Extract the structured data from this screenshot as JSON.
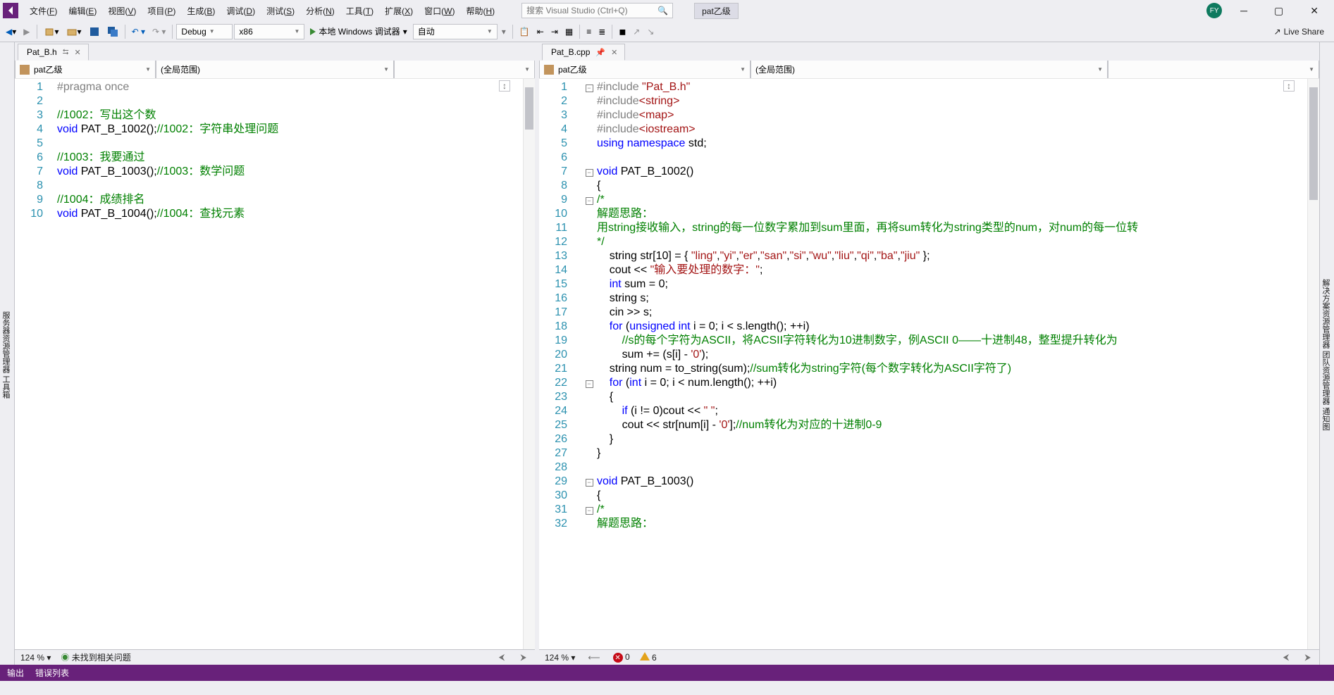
{
  "menubar": {
    "items": [
      "文件(F)",
      "编辑(E)",
      "视图(V)",
      "项目(P)",
      "生成(B)",
      "调试(D)",
      "测试(S)",
      "分析(N)",
      "工具(T)",
      "扩展(X)",
      "窗口(W)",
      "帮助(H)"
    ],
    "search_placeholder": "搜索 Visual Studio (Ctrl+Q)",
    "solution_name": "pat乙级",
    "avatar": "FY"
  },
  "toolbar": {
    "config": "Debug",
    "platform": "x86",
    "debug_label": "本地 Windows 调试器",
    "auto_label": "自动",
    "live_share": "Live Share"
  },
  "left_pane": {
    "tab": "Pat_B.h",
    "project": "pat乙级",
    "scope": "(全局范围)",
    "zoom": "124 %",
    "issues_msg": "未找到相关问题",
    "lines": [
      {
        "n": 1,
        "p": [
          {
            "t": "#pragma",
            "c": "prag"
          },
          {
            "t": " ",
            "c": ""
          },
          {
            "t": "once",
            "c": "prag"
          }
        ]
      },
      {
        "n": 2,
        "p": []
      },
      {
        "n": 3,
        "p": [
          {
            "t": "//1002：写出这个数",
            "c": "cmt"
          }
        ]
      },
      {
        "n": 4,
        "p": [
          {
            "t": "void",
            "c": "kw"
          },
          {
            "t": " PAT_B_1002();",
            "c": ""
          },
          {
            "t": "//1002：字符串处理问题",
            "c": "cmt"
          }
        ]
      },
      {
        "n": 5,
        "p": []
      },
      {
        "n": 6,
        "p": [
          {
            "t": "//1003：我要通过",
            "c": "cmt"
          }
        ]
      },
      {
        "n": 7,
        "p": [
          {
            "t": "void",
            "c": "kw"
          },
          {
            "t": " PAT_B_1003();",
            "c": ""
          },
          {
            "t": "//1003：数学问题",
            "c": "cmt"
          }
        ]
      },
      {
        "n": 8,
        "p": []
      },
      {
        "n": 9,
        "p": [
          {
            "t": "//1004：成绩排名",
            "c": "cmt"
          }
        ]
      },
      {
        "n": 10,
        "p": [
          {
            "t": "void",
            "c": "kw"
          },
          {
            "t": " PAT_B_1004();",
            "c": ""
          },
          {
            "t": "//1004：查找元素",
            "c": "cmt"
          }
        ]
      }
    ]
  },
  "right_pane": {
    "tab": "Pat_B.cpp",
    "project": "pat乙级",
    "scope": "(全局范围)",
    "zoom": "124 %",
    "errors": "0",
    "warnings": "6",
    "lines": [
      {
        "n": 1,
        "f": "-",
        "p": [
          {
            "t": "#include ",
            "c": "prag"
          },
          {
            "t": "\"Pat_B.h\"",
            "c": "inc"
          }
        ]
      },
      {
        "n": 2,
        "f": "",
        "p": [
          {
            "t": "#include",
            "c": "prag"
          },
          {
            "t": "<string>",
            "c": "inc"
          }
        ]
      },
      {
        "n": 3,
        "f": "",
        "p": [
          {
            "t": "#include",
            "c": "prag"
          },
          {
            "t": "<map>",
            "c": "inc"
          }
        ]
      },
      {
        "n": 4,
        "f": "",
        "p": [
          {
            "t": "#include",
            "c": "prag"
          },
          {
            "t": "<iostream>",
            "c": "inc"
          }
        ]
      },
      {
        "n": 5,
        "f": "",
        "p": [
          {
            "t": "using",
            "c": "kw"
          },
          {
            "t": " ",
            "c": ""
          },
          {
            "t": "namespace",
            "c": "kw"
          },
          {
            "t": " std;",
            "c": ""
          }
        ]
      },
      {
        "n": 6,
        "f": "",
        "p": []
      },
      {
        "n": 7,
        "f": "-",
        "p": [
          {
            "t": "void",
            "c": "kw"
          },
          {
            "t": " PAT_B_1002()",
            "c": ""
          }
        ]
      },
      {
        "n": 8,
        "f": "",
        "p": [
          {
            "t": "{",
            "c": ""
          }
        ]
      },
      {
        "n": 9,
        "f": "-",
        "p": [
          {
            "t": "/*",
            "c": "cmt"
          }
        ]
      },
      {
        "n": 10,
        "f": "",
        "p": [
          {
            "t": "解题思路：",
            "c": "cmt"
          }
        ]
      },
      {
        "n": 11,
        "f": "",
        "p": [
          {
            "t": "用string接收输入，string的每一位数字累加到sum里面，再将sum转化为string类型的num，对num的每一位转",
            "c": "cmt"
          }
        ]
      },
      {
        "n": 12,
        "f": "",
        "p": [
          {
            "t": "*/",
            "c": "cmt"
          }
        ]
      },
      {
        "n": 13,
        "f": "",
        "p": [
          {
            "t": "    string str[10] = { ",
            "c": ""
          },
          {
            "t": "\"ling\"",
            "c": "str"
          },
          {
            "t": ",",
            "c": ""
          },
          {
            "t": "\"yi\"",
            "c": "str"
          },
          {
            "t": ",",
            "c": ""
          },
          {
            "t": "\"er\"",
            "c": "str"
          },
          {
            "t": ",",
            "c": ""
          },
          {
            "t": "\"san\"",
            "c": "str"
          },
          {
            "t": ",",
            "c": ""
          },
          {
            "t": "\"si\"",
            "c": "str"
          },
          {
            "t": ",",
            "c": ""
          },
          {
            "t": "\"wu\"",
            "c": "str"
          },
          {
            "t": ",",
            "c": ""
          },
          {
            "t": "\"liu\"",
            "c": "str"
          },
          {
            "t": ",",
            "c": ""
          },
          {
            "t": "\"qi\"",
            "c": "str"
          },
          {
            "t": ",",
            "c": ""
          },
          {
            "t": "\"ba\"",
            "c": "str"
          },
          {
            "t": ",",
            "c": ""
          },
          {
            "t": "\"jiu\"",
            "c": "str"
          },
          {
            "t": " };",
            "c": ""
          }
        ]
      },
      {
        "n": 14,
        "f": "",
        "p": [
          {
            "t": "    cout << ",
            "c": ""
          },
          {
            "t": "\"输入要处理的数字：\"",
            "c": "str"
          },
          {
            "t": ";",
            "c": ""
          }
        ]
      },
      {
        "n": 15,
        "f": "",
        "p": [
          {
            "t": "    ",
            "c": ""
          },
          {
            "t": "int",
            "c": "kw"
          },
          {
            "t": " sum = 0;",
            "c": ""
          }
        ]
      },
      {
        "n": 16,
        "f": "",
        "p": [
          {
            "t": "    string s;",
            "c": ""
          }
        ]
      },
      {
        "n": 17,
        "f": "",
        "p": [
          {
            "t": "    cin >> s;",
            "c": ""
          }
        ]
      },
      {
        "n": 18,
        "f": "",
        "p": [
          {
            "t": "    ",
            "c": ""
          },
          {
            "t": "for",
            "c": "kw"
          },
          {
            "t": " (",
            "c": ""
          },
          {
            "t": "unsigned",
            "c": "kw"
          },
          {
            "t": " ",
            "c": ""
          },
          {
            "t": "int",
            "c": "kw"
          },
          {
            "t": " i = 0; i < s.length(); ++i)",
            "c": ""
          }
        ]
      },
      {
        "n": 19,
        "f": "",
        "p": [
          {
            "t": "        ",
            "c": ""
          },
          {
            "t": "//s的每个字符为ASCII，将ACSII字符转化为10进制数字，例ASCII 0——十进制48，整型提升转化为",
            "c": "cmt"
          }
        ]
      },
      {
        "n": 20,
        "f": "",
        "p": [
          {
            "t": "        sum += (s[i] - ",
            "c": ""
          },
          {
            "t": "'0'",
            "c": "str"
          },
          {
            "t": ");",
            "c": ""
          }
        ]
      },
      {
        "n": 21,
        "f": "",
        "p": [
          {
            "t": "    string num = to_string(sum);",
            "c": ""
          },
          {
            "t": "//sum转化为string字符(每个数字转化为ASCII字符了)",
            "c": "cmt"
          }
        ]
      },
      {
        "n": 22,
        "f": "-",
        "p": [
          {
            "t": "    ",
            "c": ""
          },
          {
            "t": "for",
            "c": "kw"
          },
          {
            "t": " (",
            "c": ""
          },
          {
            "t": "int",
            "c": "kw"
          },
          {
            "t": " i = 0; i < num.length(); ++i)",
            "c": ""
          }
        ]
      },
      {
        "n": 23,
        "f": "",
        "p": [
          {
            "t": "    {",
            "c": ""
          }
        ]
      },
      {
        "n": 24,
        "f": "",
        "p": [
          {
            "t": "        ",
            "c": ""
          },
          {
            "t": "if",
            "c": "kw"
          },
          {
            "t": " (i != 0)cout << ",
            "c": ""
          },
          {
            "t": "\" \"",
            "c": "str"
          },
          {
            "t": ";",
            "c": ""
          }
        ]
      },
      {
        "n": 25,
        "f": "",
        "p": [
          {
            "t": "        cout << str[num[i] - ",
            "c": ""
          },
          {
            "t": "'0'",
            "c": "str"
          },
          {
            "t": "];",
            "c": ""
          },
          {
            "t": "//num转化为对应的十进制0-9",
            "c": "cmt"
          }
        ]
      },
      {
        "n": 26,
        "f": "",
        "p": [
          {
            "t": "    }",
            "c": ""
          }
        ]
      },
      {
        "n": 27,
        "f": "",
        "p": [
          {
            "t": "}",
            "c": ""
          }
        ]
      },
      {
        "n": 28,
        "f": "",
        "p": []
      },
      {
        "n": 29,
        "f": "-",
        "p": [
          {
            "t": "void",
            "c": "kw"
          },
          {
            "t": " PAT_B_1003()",
            "c": ""
          }
        ]
      },
      {
        "n": 30,
        "f": "",
        "p": [
          {
            "t": "{",
            "c": ""
          }
        ]
      },
      {
        "n": 31,
        "f": "-",
        "p": [
          {
            "t": "/*",
            "c": "cmt"
          }
        ]
      },
      {
        "n": 32,
        "f": "",
        "p": [
          {
            "t": "解题思路：",
            "c": "cmt"
          }
        ]
      }
    ]
  },
  "bottom": {
    "output": "输出",
    "errlist": "错误列表"
  },
  "side_left": "服务器资源管理器  工具箱",
  "side_right": "解决方案资源管理器   团队资源管理器   通知图"
}
